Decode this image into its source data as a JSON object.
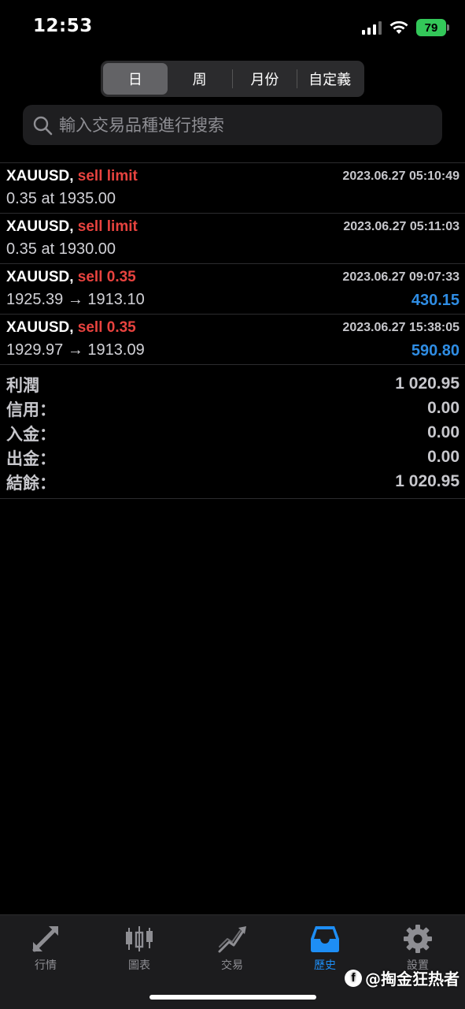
{
  "status": {
    "time": "12:53",
    "battery": "79"
  },
  "segments": [
    {
      "label": "日",
      "active": true
    },
    {
      "label": "周",
      "active": false
    },
    {
      "label": "月份",
      "active": false
    },
    {
      "label": "自定義",
      "active": false
    }
  ],
  "search": {
    "placeholder": "輸入交易品種進行搜索"
  },
  "orders": [
    {
      "symbol": "XAUUSD,",
      "action": "sell limit",
      "time": "2023.06.27 05:10:49",
      "detail": "0.35 at 1935.00",
      "profit": ""
    },
    {
      "symbol": "XAUUSD,",
      "action": "sell limit",
      "time": "2023.06.27 05:11:03",
      "detail": "0.35 at 1930.00",
      "profit": ""
    },
    {
      "symbol": "XAUUSD,",
      "action": "sell 0.35",
      "time": "2023.06.27 09:07:33",
      "detail": "1925.39 → 1913.10",
      "profit": "430.15"
    },
    {
      "symbol": "XAUUSD,",
      "action": "sell 0.35",
      "time": "2023.06.27 15:38:05",
      "detail": "1929.97 → 1913.09",
      "profit": "590.80"
    }
  ],
  "summary": [
    {
      "label": "利潤",
      "value": "1 020.95"
    },
    {
      "label": "信用：",
      "value": "0.00"
    },
    {
      "label": "入金：",
      "value": "0.00"
    },
    {
      "label": "出金：",
      "value": "0.00"
    },
    {
      "label": "結餘：",
      "value": "1 020.95"
    }
  ],
  "tabs": [
    {
      "label": "行情",
      "icon": "quotes-arrows-icon",
      "active": false
    },
    {
      "label": "圖表",
      "icon": "candlestick-chart-icon",
      "active": false
    },
    {
      "label": "交易",
      "icon": "trade-trend-icon",
      "active": false
    },
    {
      "label": "歷史",
      "icon": "history-inbox-icon",
      "active": true
    },
    {
      "label": "設置",
      "icon": "gear-icon",
      "active": false
    }
  ],
  "watermark": {
    "text": "@掏金狂热者"
  },
  "colors": {
    "accent": "#1e8ef5",
    "sell": "#e8433f",
    "profit": "#2f8de4",
    "battery": "#33c759"
  }
}
